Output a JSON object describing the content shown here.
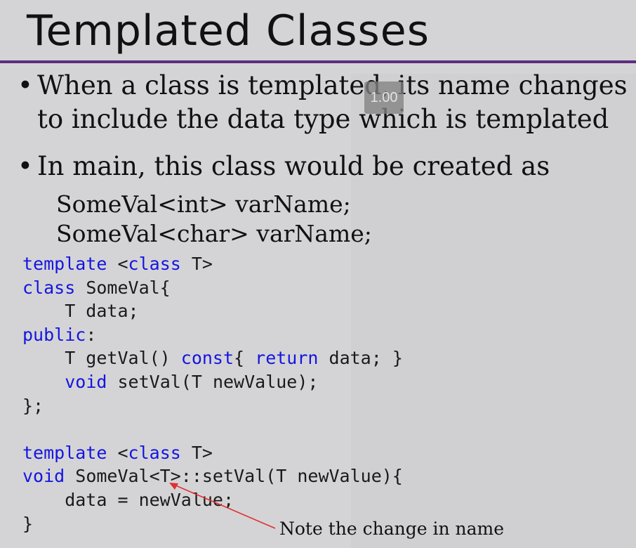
{
  "slide": {
    "title": "Templated Classes",
    "bullets": [
      {
        "marker": "•",
        "text": "When a class is templated, its name changes to include the data type which is templated"
      },
      {
        "marker": "•",
        "text": "In main, this class would be created as"
      }
    ],
    "examples": [
      "SomeVal<int> varName;",
      "SomeVal<char> varName;"
    ],
    "code": {
      "lines": [
        [
          {
            "t": "template",
            "kw": true
          },
          {
            "t": " "
          },
          {
            "t": "<"
          },
          {
            "t": "class",
            "kw": true
          },
          {
            "t": " T>"
          }
        ],
        [
          {
            "t": "class",
            "kw": true
          },
          {
            "t": " SomeVal{"
          }
        ],
        [
          {
            "t": "    T data;"
          }
        ],
        [
          {
            "t": "public",
            "kw": true
          },
          {
            "t": ":"
          }
        ],
        [
          {
            "t": "    T getVal() "
          },
          {
            "t": "const",
            "kw": true
          },
          {
            "t": "{ "
          },
          {
            "t": "return",
            "kw": true
          },
          {
            "t": " data; }"
          }
        ],
        [
          {
            "t": "    "
          },
          {
            "t": "void",
            "kw": true
          },
          {
            "t": " setVal(T newValue);"
          }
        ],
        [
          {
            "t": "};"
          }
        ],
        [
          {
            "t": ""
          }
        ],
        [
          {
            "t": "template",
            "kw": true
          },
          {
            "t": " "
          },
          {
            "t": "<"
          },
          {
            "t": "class",
            "kw": true
          },
          {
            "t": " T>"
          }
        ],
        [
          {
            "t": "void",
            "kw": true
          },
          {
            "t": " SomeVal<T>::setVal(T newValue){"
          }
        ],
        [
          {
            "t": "    data = newValue;"
          }
        ],
        [
          {
            "t": "}"
          }
        ]
      ]
    },
    "annotation": "Note the change in name",
    "playback_speed": "1.00"
  },
  "colors": {
    "keyword": "#1515e0",
    "title_rule": "#5c2d7e",
    "arrow": "#e03030",
    "background": "#d4d4d6"
  }
}
